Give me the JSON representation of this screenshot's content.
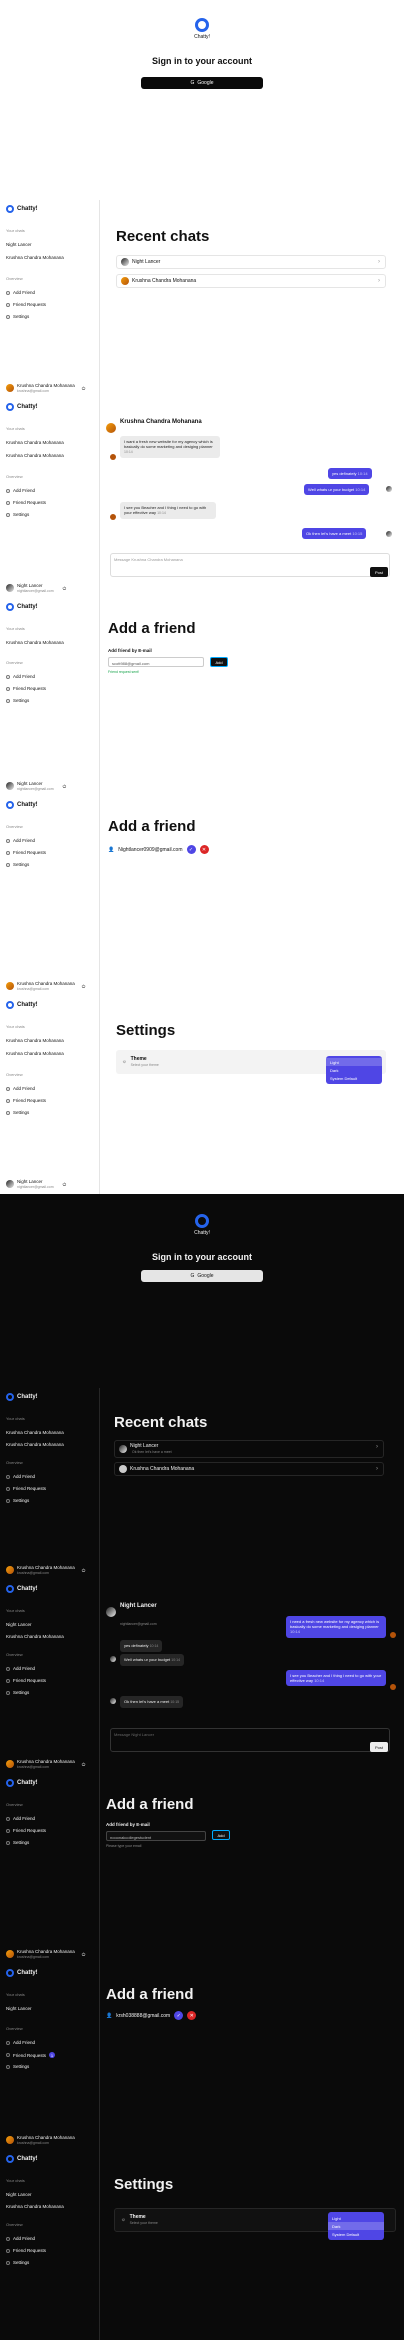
{
  "app": {
    "name": "Chatty!"
  },
  "login": {
    "title": "Sign in to your account",
    "google_label": "Google"
  },
  "sidebar": {
    "friends_heading": "Your chats",
    "overview_heading": "Overview",
    "add_friend": "Add Friend",
    "friend_requests": "Friend Requests",
    "settings": "Settings",
    "request_count": "1"
  },
  "users": {
    "krushna": {
      "name": "Krushna Chandra Mohanana",
      "short": "Krushna Chandra Mohanana",
      "email": "krushna@gmail.com"
    },
    "night": {
      "name": "Night Lancer",
      "email": "nightlancer@gmail.com"
    }
  },
  "recent": {
    "title": "Recent chats",
    "light": [
      {
        "name": "Night Lancer",
        "preview": ""
      },
      {
        "name": "Krushna Chandra Mohanana",
        "preview": ""
      }
    ],
    "dark": [
      {
        "name": "Night Lancer",
        "preview": "Ok then let's have a meet"
      },
      {
        "name": "Krushna Chandra Mohanana",
        "preview": ""
      }
    ]
  },
  "chat_light": {
    "messages": [
      {
        "text": "I want a fresh new website for my agency which is basically do some marketing and desiging planner",
        "time": "10:14",
        "from": "them"
      },
      {
        "text": "yes definately",
        "time": "10:14",
        "from": "me"
      },
      {
        "text": "Well whats ur your budget",
        "time": "10:14",
        "from": "me"
      },
      {
        "text": "I see you Beacher and I thing i need to go with your effective way",
        "time": "10:14",
        "from": "them"
      },
      {
        "text": "Ok then let's have a meet",
        "time": "10:15",
        "from": "me"
      }
    ],
    "placeholder": "Message Krushna Chandra Mohanana",
    "send": "Post"
  },
  "chat_dark": {
    "messages": [
      {
        "text": "I need a fresh new website for my agency which is basically do some marketing and desiging planner",
        "time": "10:14",
        "from": "them"
      },
      {
        "text": "yes definately",
        "time": "10:14",
        "from": "me"
      },
      {
        "text": "Well whats ur your budget",
        "time": "10:14",
        "from": "me"
      },
      {
        "text": "I see you Beacher and I thing i need to go with your effective way",
        "time": "10:14",
        "from": "them"
      },
      {
        "text": "Ok then let's have a meet",
        "time": "10:15",
        "from": "me"
      }
    ],
    "placeholder": "Message Night Lancer",
    "send": "Post"
  },
  "addfriend": {
    "title": "Add a friend",
    "label": "Add friend by E-mail",
    "input_value": "scott988@gmail.com",
    "input_value_dark": "nooonakcollegestudent",
    "add_label": "Add",
    "success": "Friend request sent!",
    "dark_hint": "Please type your email"
  },
  "requests": {
    "light_email": "Nightlancer0909@gmail.com",
    "dark_email": "krsh038888@gmail.com"
  },
  "settings": {
    "title": "Settings",
    "theme_label": "Theme",
    "theme_sub": "Select your theme",
    "options": [
      "Light",
      "Dark",
      "System Default"
    ]
  }
}
